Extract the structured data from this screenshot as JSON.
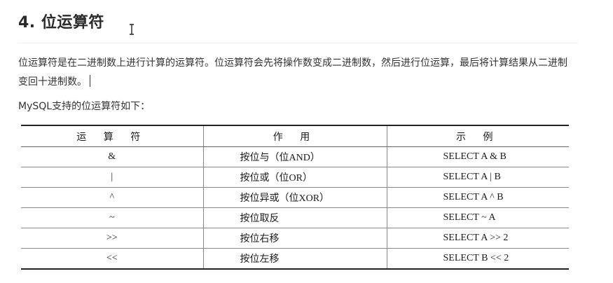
{
  "heading": "4. 位运算符",
  "paragraph": "位运算符是在二进制数上进行计算的运算符。位运算符会先将操作数变成二进制数，然后进行位运算，最后将计算结果从二进制变回十进制数。",
  "intro": "MySQL支持的位运算符如下：",
  "table": {
    "headers": [
      "运 算 符",
      "作 用",
      "示 例"
    ],
    "rows": [
      [
        "&",
        "按位与（位AND）",
        "SELECT A & B"
      ],
      [
        "|",
        "按位或（位OR）",
        "SELECT A | B"
      ],
      [
        "^",
        "按位异或（位XOR）",
        "SELECT A ^ B"
      ],
      [
        "~",
        "按位取反",
        "SELECT ~ A"
      ],
      [
        ">>",
        "按位右移",
        "SELECT A >> 2"
      ],
      [
        "<<",
        "按位左移",
        "SELECT B << 2"
      ]
    ]
  }
}
